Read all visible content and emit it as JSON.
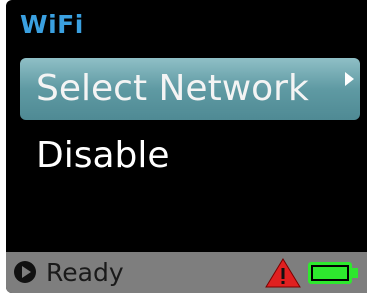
{
  "header": {
    "title": "WiFi"
  },
  "menu": {
    "items": [
      {
        "label": "Select Network",
        "selected": true,
        "has_submenu": true
      },
      {
        "label": "Disable",
        "selected": false,
        "has_submenu": false
      }
    ]
  },
  "statusbar": {
    "status_text": "Ready",
    "icons": [
      "play-circle-icon",
      "warning-icon",
      "battery-icon"
    ],
    "battery_level": 1.0
  },
  "colors": {
    "title": "#3aa0e0",
    "selected_bg": "#5f9aa3",
    "statusbar_bg": "#7e7e7e",
    "battery": "#2ee82e",
    "warning": "#e02020"
  }
}
